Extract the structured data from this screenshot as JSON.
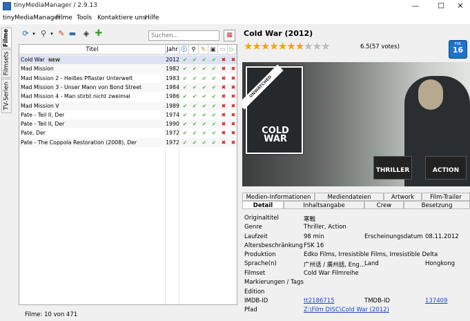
{
  "window": {
    "title": "tinyMediaManager / 2.9.13",
    "minimize": "—",
    "maximize": "☐",
    "close": "✕"
  },
  "menu": [
    "tinyMediaManager",
    "Filme",
    "Tools",
    "Kontaktiere uns",
    "Hilfe"
  ],
  "side_tabs": [
    "Filme",
    "Filmsets",
    "TV-Serien"
  ],
  "toolbar": {
    "search_placeholder": "Suchen..."
  },
  "table": {
    "headers": {
      "title": "Titel",
      "year": "Jahr"
    },
    "rows": [
      {
        "title": "Cold War",
        "new": "NEW",
        "year": "2012",
        "flags": [
          "ok",
          "ok",
          "ok",
          "ok",
          "no",
          "no"
        ]
      },
      {
        "title": "Mad Mission",
        "year": "1982",
        "flags": [
          "ok",
          "ok",
          "ok",
          "ok",
          "no",
          "no"
        ]
      },
      {
        "title": "Mad Mission 2 - Heißes Pflaster Unterwelt",
        "year": "1983",
        "flags": [
          "ok",
          "ok",
          "ok",
          "ok",
          "no",
          "no"
        ]
      },
      {
        "title": "Mad Mission 3 - Unser Mann von Bond Street",
        "year": "1984",
        "flags": [
          "ok",
          "ok",
          "ok",
          "ok",
          "no",
          "no"
        ]
      },
      {
        "title": "Mad Mission 4 - Man stirbt nicht zweimal",
        "year": "1986",
        "flags": [
          "ok",
          "ok",
          "ok",
          "ok",
          "no",
          "no"
        ]
      },
      {
        "title": "Mad Mission V",
        "year": "1989",
        "flags": [
          "ok",
          "ok",
          "ok",
          "ok",
          "no",
          "no"
        ]
      },
      {
        "title": "Pate - Teil II, Der",
        "year": "1974",
        "flags": [
          "ok",
          "ok",
          "ok",
          "ok",
          "no",
          "no"
        ]
      },
      {
        "title": "Pate - Teil II, Der",
        "year": "1990",
        "flags": [
          "ok",
          "ok",
          "ok",
          "ok",
          "no",
          "no"
        ]
      },
      {
        "title": "Pate, Der",
        "year": "1972",
        "flags": [
          "ok",
          "ok",
          "ok",
          "ok",
          "no",
          "no"
        ]
      },
      {
        "title": "Pate -  The Coppola Restoration (2008), Der",
        "year": "1972",
        "flags": [
          "ok",
          "ok",
          "ok",
          "ok",
          "no",
          "no"
        ]
      }
    ]
  },
  "status": "Filme:  10 von 471",
  "movie": {
    "title": "Cold War (2012)",
    "rating_text": "6.5(57 votes)",
    "rating": 6.5,
    "rating_max": 10,
    "certification": {
      "label": "FSK",
      "value": "16"
    },
    "poster": {
      "band": "UNWATCHED",
      "title": "COLD WAR"
    },
    "genre_badges": [
      "THRILLER",
      "ACTION"
    ]
  },
  "tabs_row1": [
    "Medien-Informationen",
    "Mediendateien",
    "Artwork",
    "Film-Trailer"
  ],
  "tabs_row2": [
    "Detail",
    "Inhaltsangabe",
    "Crew",
    "Besetzung"
  ],
  "details": {
    "original_title_label": "Originaltitel",
    "original_title": "寒戰",
    "genre_label": "Genre",
    "genre": "Thriller, Action",
    "runtime_label": "Laufzeit",
    "runtime": "98  min",
    "release_label": "Erscheinungsdatum",
    "release": "08.11.2012",
    "cert_label": "Altersbeschränkung",
    "cert": "FSK 16",
    "production_label": "Produktion",
    "production": "Edko Films, Irresistible Films, Irresistible Delta",
    "language_label": "Sprache(n)",
    "language": "广州话 / 廣州話, Eng...",
    "country_label": "Land",
    "country": "Hongkong",
    "movieset_label": "Filmset",
    "movieset": "Cold War Filmreihe",
    "tags_label": "Markierungen / Tags",
    "tags": "",
    "edition_label": "Edition",
    "edition": "",
    "imdb_label": "IMDB-ID",
    "imdb": "tt2186715",
    "tmdb_label": "TMDB-ID",
    "tmdb": "137409",
    "path_label": "Pfad",
    "path": "Z:\\Film DISC\\Cold War (2012)"
  }
}
